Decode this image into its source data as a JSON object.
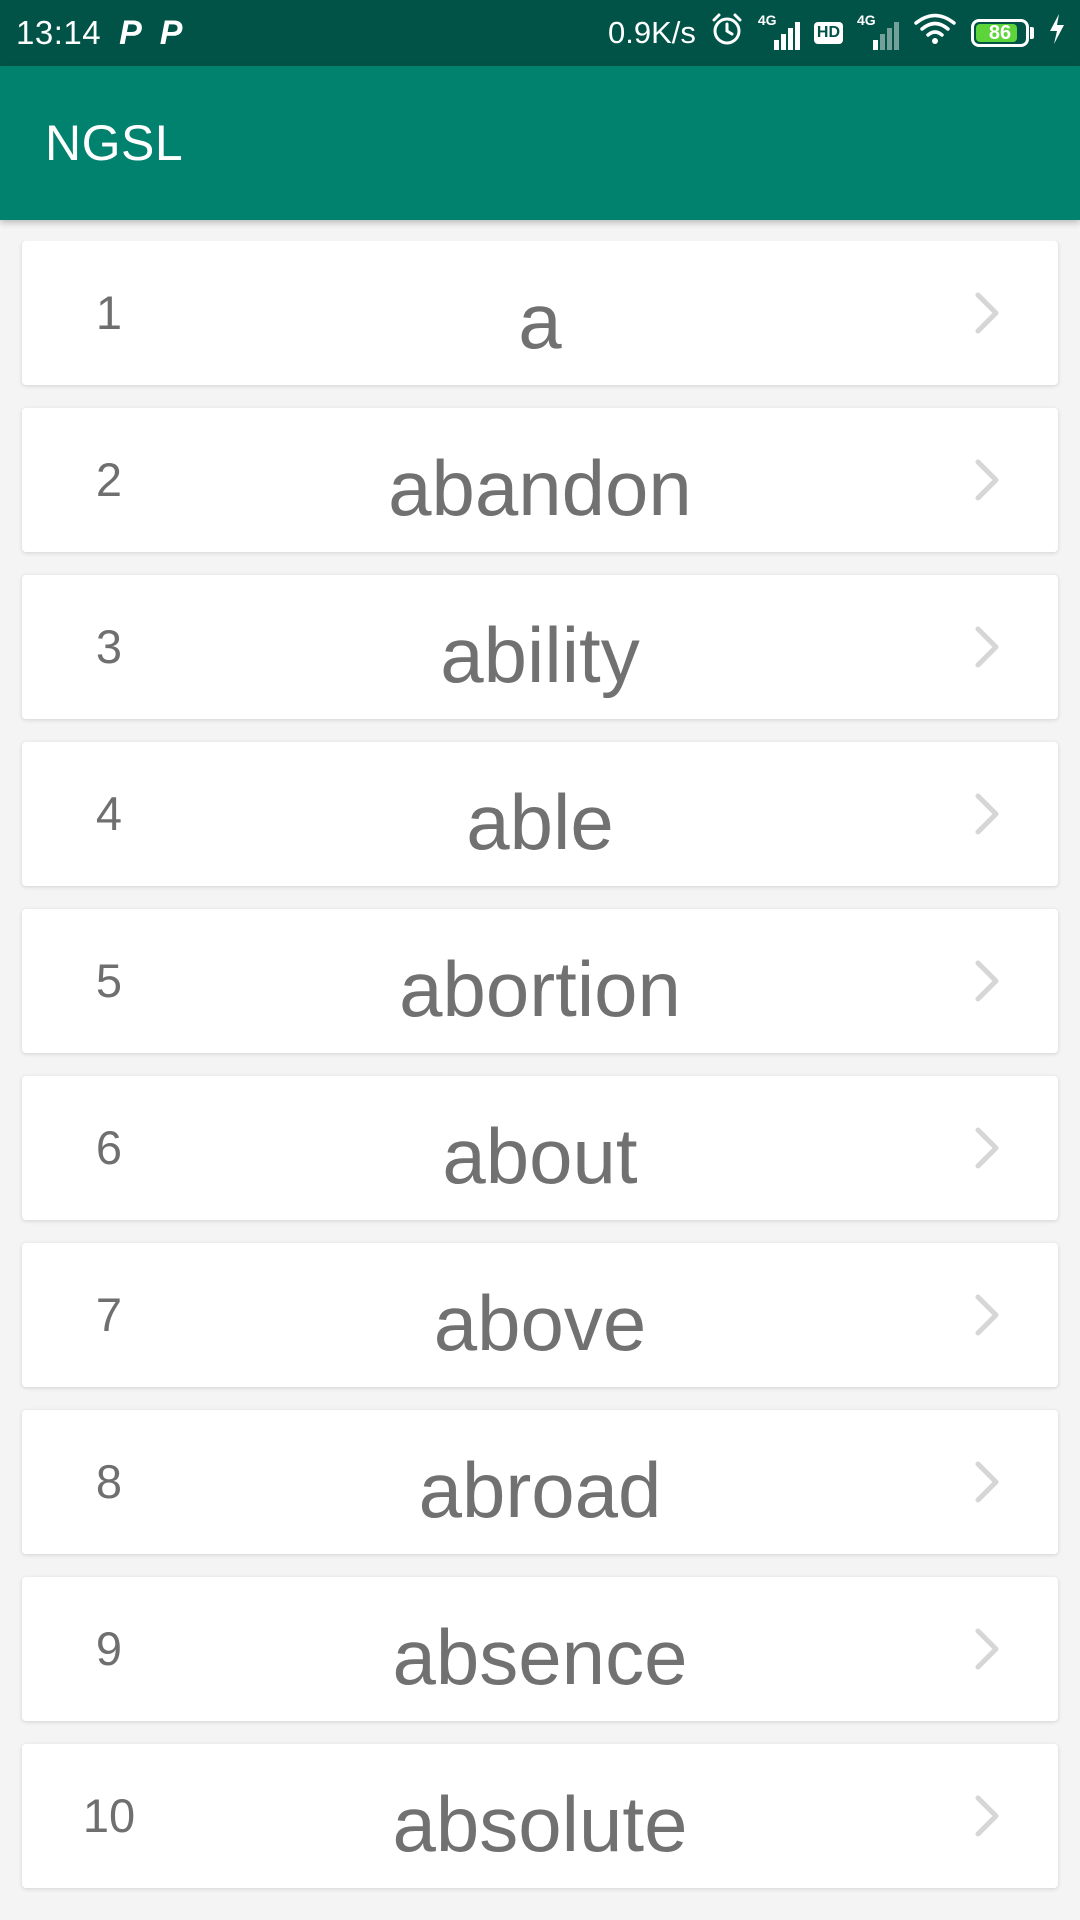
{
  "status_bar": {
    "time": "13:14",
    "notification_icons": [
      "P",
      "P"
    ],
    "net_speed": "0.9K/s",
    "signal_1_label": "4G",
    "signal_2_label": "4G",
    "hd_label": "HD",
    "battery_level": "86",
    "icons": [
      "alarm-icon",
      "signal-icon",
      "hd-icon",
      "signal-icon",
      "wifi-icon",
      "battery-icon",
      "charging-icon"
    ]
  },
  "app_bar": {
    "title": "NGSL"
  },
  "word_list": {
    "items": [
      {
        "index": "1",
        "word": "a"
      },
      {
        "index": "2",
        "word": "abandon"
      },
      {
        "index": "3",
        "word": "ability"
      },
      {
        "index": "4",
        "word": "able"
      },
      {
        "index": "5",
        "word": "abortion"
      },
      {
        "index": "6",
        "word": "about"
      },
      {
        "index": "7",
        "word": "above"
      },
      {
        "index": "8",
        "word": "abroad"
      },
      {
        "index": "9",
        "word": "absence"
      },
      {
        "index": "10",
        "word": "absolute"
      }
    ],
    "row_icon": "chevron-right-icon"
  },
  "colors": {
    "status_bar": "#005346",
    "app_bar": "#00826f",
    "background": "#f4f4f4",
    "card": "#ffffff",
    "text": "#717171",
    "chevron": "#d6d6d6",
    "battery_fill": "#5dd43a"
  }
}
